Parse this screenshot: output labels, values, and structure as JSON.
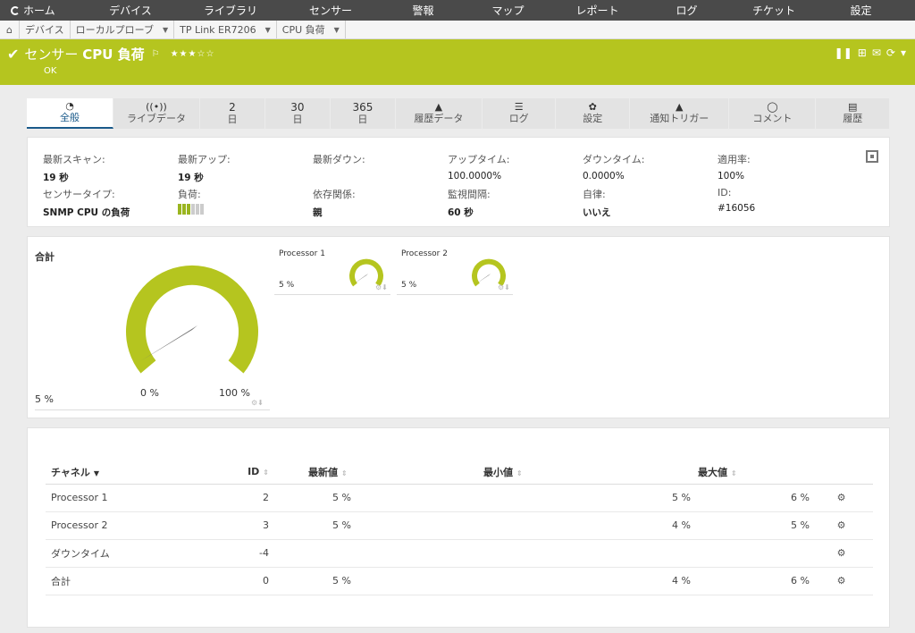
{
  "nav": {
    "items": [
      "ホーム",
      "デバイス",
      "ライブラリ",
      "センサー",
      "警報",
      "マップ",
      "レポート",
      "ログ",
      "チケット",
      "設定"
    ]
  },
  "breadcrumb": [
    "デバイス",
    "ローカルプローブ",
    "TP Link ER7206",
    "CPU 負荷"
  ],
  "header": {
    "prefix": "センサー",
    "name": "CPU 負荷",
    "stars": "★★★☆☆",
    "status": "OK",
    "accent": "#b5c51f"
  },
  "tabs": [
    {
      "icon": "◔",
      "label": "全般"
    },
    {
      "icon": "((•))",
      "label": "ライブデータ"
    },
    {
      "icon": "2",
      "label": "日"
    },
    {
      "icon": "30",
      "label": "日"
    },
    {
      "icon": "365",
      "label": "日"
    },
    {
      "icon": "▲",
      "label": "履歴データ"
    },
    {
      "icon": "☰",
      "label": "ログ"
    },
    {
      "icon": "✿",
      "label": "設定"
    },
    {
      "icon": "▲",
      "label": "通知トリガー"
    },
    {
      "icon": "◯",
      "label": "コメント"
    },
    {
      "icon": "▤",
      "label": "履歴"
    }
  ],
  "info": {
    "last_scan_label": "最新スキャン:",
    "last_scan": "19 秒",
    "last_up_label": "最新アップ:",
    "last_up": "19 秒",
    "last_down_label": "最新ダウン:",
    "uptime_label": "アップタイム:",
    "uptime": "100.0000%",
    "downtime_label": "ダウンタイム:",
    "downtime": "0.0000%",
    "coverage_label": "適用率:",
    "coverage": "100%",
    "sensor_type_label": "センサータイプ:",
    "sensor_type": "SNMP CPU の負荷",
    "load_label": "負荷:",
    "load_level": 0.5,
    "dependency_label": "依存関係:",
    "dependency": "親",
    "interval_label": "監視間隔:",
    "interval": "60 秒",
    "autonomy_label": "自律:",
    "autonomy": "いいえ",
    "id_label": "ID:",
    "id": "#16056"
  },
  "gauges": {
    "total_title": "合計",
    "total_value": "5 %",
    "min_label": "0 %",
    "max_label": "100 %",
    "proc1_title": "Processor 1",
    "proc1_value": "5 %",
    "proc2_title": "Processor 2",
    "proc2_value": "5 %"
  },
  "table": {
    "headers": {
      "channel": "チャネル",
      "id": "ID",
      "last": "最新値",
      "min": "最小値",
      "max": "最大値"
    },
    "rows": [
      {
        "channel": "Processor 1",
        "id": "2",
        "last": "5 %",
        "min": "5 %",
        "max": "6 %"
      },
      {
        "channel": "Processor 2",
        "id": "3",
        "last": "5 %",
        "min": "4 %",
        "max": "5 %"
      },
      {
        "channel": "ダウンタイム",
        "id": "-4",
        "last": "",
        "min": "",
        "max": ""
      },
      {
        "channel": "合計",
        "id": "0",
        "last": "5 %",
        "min": "4 %",
        "max": "6 %"
      }
    ]
  }
}
